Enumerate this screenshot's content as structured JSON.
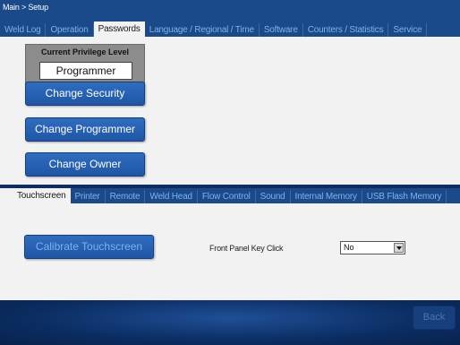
{
  "breadcrumb": "Main > Setup",
  "top_tabs": [
    {
      "label": "Weld Log",
      "active": false
    },
    {
      "label": "Operation",
      "active": false
    },
    {
      "label": "Passwords",
      "active": true
    },
    {
      "label": "Language / Regional / Time",
      "active": false
    },
    {
      "label": "Software",
      "active": false
    },
    {
      "label": "Counters / Statistics",
      "active": false
    },
    {
      "label": "Service",
      "active": false
    }
  ],
  "privilege": {
    "label": "Current Privilege Level",
    "value": "Programmer"
  },
  "buttons": {
    "change_security": "Change Security",
    "change_programmer": "Change Programmer",
    "change_owner": "Change Owner",
    "calibrate": "Calibrate Touchscreen",
    "back": "Back"
  },
  "bottom_tabs": [
    {
      "label": "Touchscreen",
      "active": true
    },
    {
      "label": "Printer",
      "active": false
    },
    {
      "label": "Remote",
      "active": false
    },
    {
      "label": "Weld Head",
      "active": false
    },
    {
      "label": "Flow Control",
      "active": false
    },
    {
      "label": "Sound",
      "active": false
    },
    {
      "label": "Internal Memory",
      "active": false
    },
    {
      "label": "USB Flash Memory",
      "active": false
    }
  ],
  "key_click": {
    "label": "Front Panel Key Click",
    "value": "No"
  },
  "colors": {
    "panel": "#f2f2f2",
    "header": "#1a4a8a",
    "button": "#1f56a6",
    "inactive_tab_text": "#7fb2e6"
  }
}
